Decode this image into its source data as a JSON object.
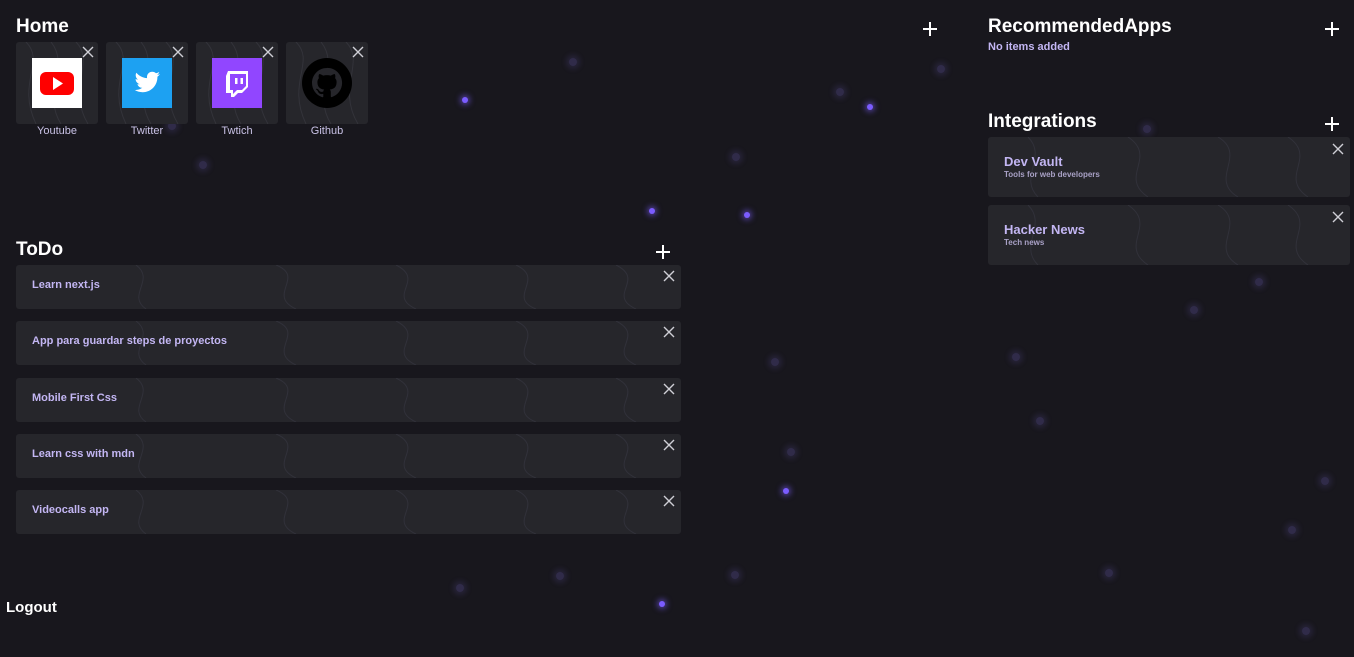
{
  "home": {
    "title": "Home",
    "shortcuts": [
      {
        "label": "Youtube",
        "icon": "youtube-icon",
        "color": "#ff0000"
      },
      {
        "label": "Twitter",
        "icon": "twitter-icon",
        "color": "#1da1f2"
      },
      {
        "label": "Twtich",
        "icon": "twitch-icon",
        "color": "#9146ff"
      },
      {
        "label": "Github",
        "icon": "github-icon",
        "color": "#000000"
      }
    ]
  },
  "todo": {
    "title": "ToDo",
    "items": [
      "Learn next.js",
      "App para guardar steps de proyectos",
      "Mobile First Css",
      "Learn css with mdn",
      "Videocalls app"
    ]
  },
  "recommended": {
    "title": "RecommendedApps",
    "empty_text": "No items added"
  },
  "integrations": {
    "title": "Integrations",
    "items": [
      {
        "title": "Dev Vault",
        "subtitle": "Tools for web developers"
      },
      {
        "title": "Hacker News",
        "subtitle": "Tech news"
      }
    ]
  },
  "logout_label": "Logout",
  "colors": {
    "background": "#18171d",
    "card": "#26262b",
    "accent_text": "#c3b6f3",
    "particle": "#7b5cff"
  }
}
